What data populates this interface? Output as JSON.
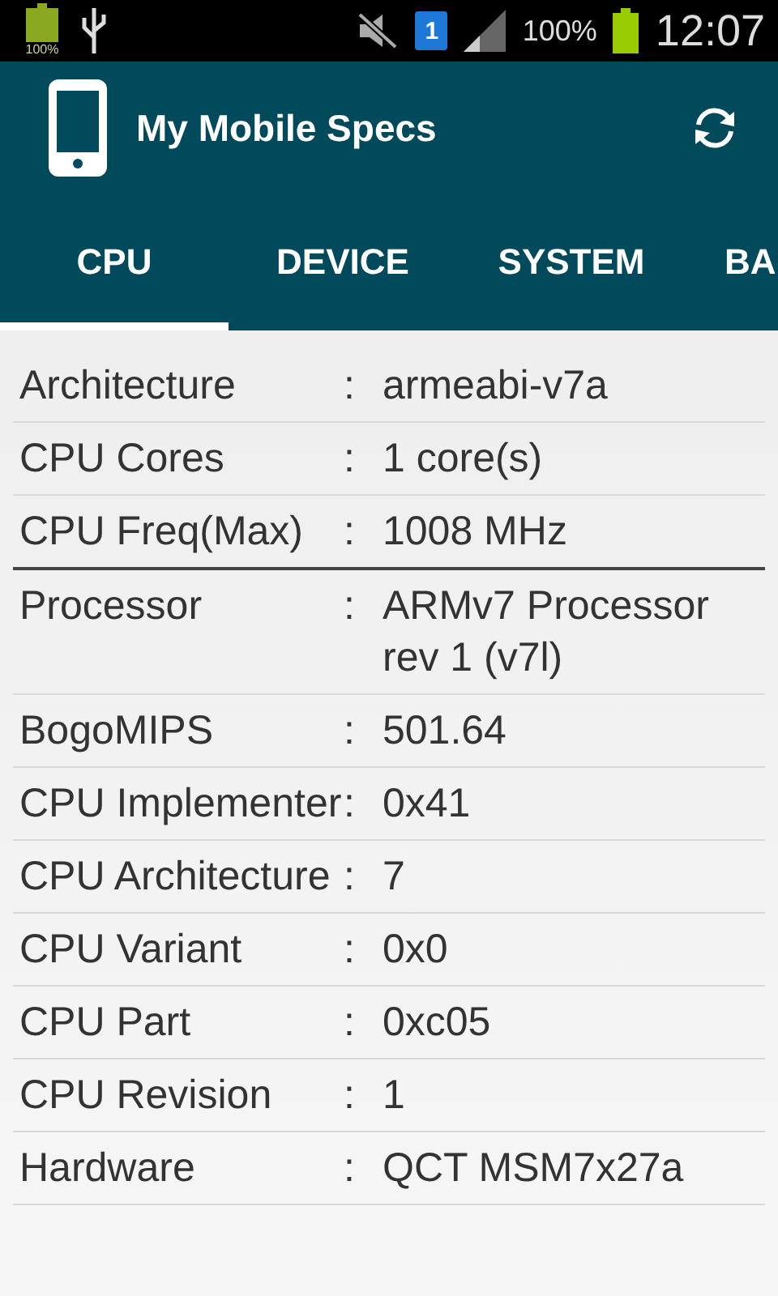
{
  "status_bar": {
    "left_battery_label": "100%",
    "notification_badge": "1",
    "battery_percent": "100%",
    "time": "12:07"
  },
  "app_bar": {
    "title": "My Mobile Specs"
  },
  "tabs": [
    {
      "label": "CPU",
      "selected": true
    },
    {
      "label": "DEVICE",
      "selected": false
    },
    {
      "label": "SYSTEM",
      "selected": false
    },
    {
      "label": "BA",
      "selected": false
    }
  ],
  "rows": [
    {
      "label": "Architecture",
      "separator": ":",
      "value": "armeabi-v7a",
      "strong_divider": false
    },
    {
      "label": "CPU Cores",
      "separator": ":",
      "value": "1 core(s)",
      "strong_divider": false
    },
    {
      "label": "CPU Freq(Max)",
      "separator": ":",
      "value": "1008 MHz",
      "strong_divider": true
    },
    {
      "label": "Processor",
      "separator": ":",
      "value": "ARMv7 Processor rev 1 (v7l)",
      "strong_divider": false
    },
    {
      "label": "BogoMIPS",
      "separator": ":",
      "value": "501.64",
      "strong_divider": false
    },
    {
      "label": "CPU Implementer",
      "separator": ":",
      "value": "0x41",
      "strong_divider": false
    },
    {
      "label": "CPU Architecture",
      "separator": ":",
      "value": "7",
      "strong_divider": false
    },
    {
      "label": "CPU Variant",
      "separator": ":",
      "value": "0x0",
      "strong_divider": false
    },
    {
      "label": "CPU Part",
      "separator": ":",
      "value": "0xc05",
      "strong_divider": false
    },
    {
      "label": "CPU Revision",
      "separator": ":",
      "value": "1",
      "strong_divider": false
    },
    {
      "label": "Hardware",
      "separator": ":",
      "value": "QCT MSM7x27a",
      "strong_divider": false
    }
  ]
}
